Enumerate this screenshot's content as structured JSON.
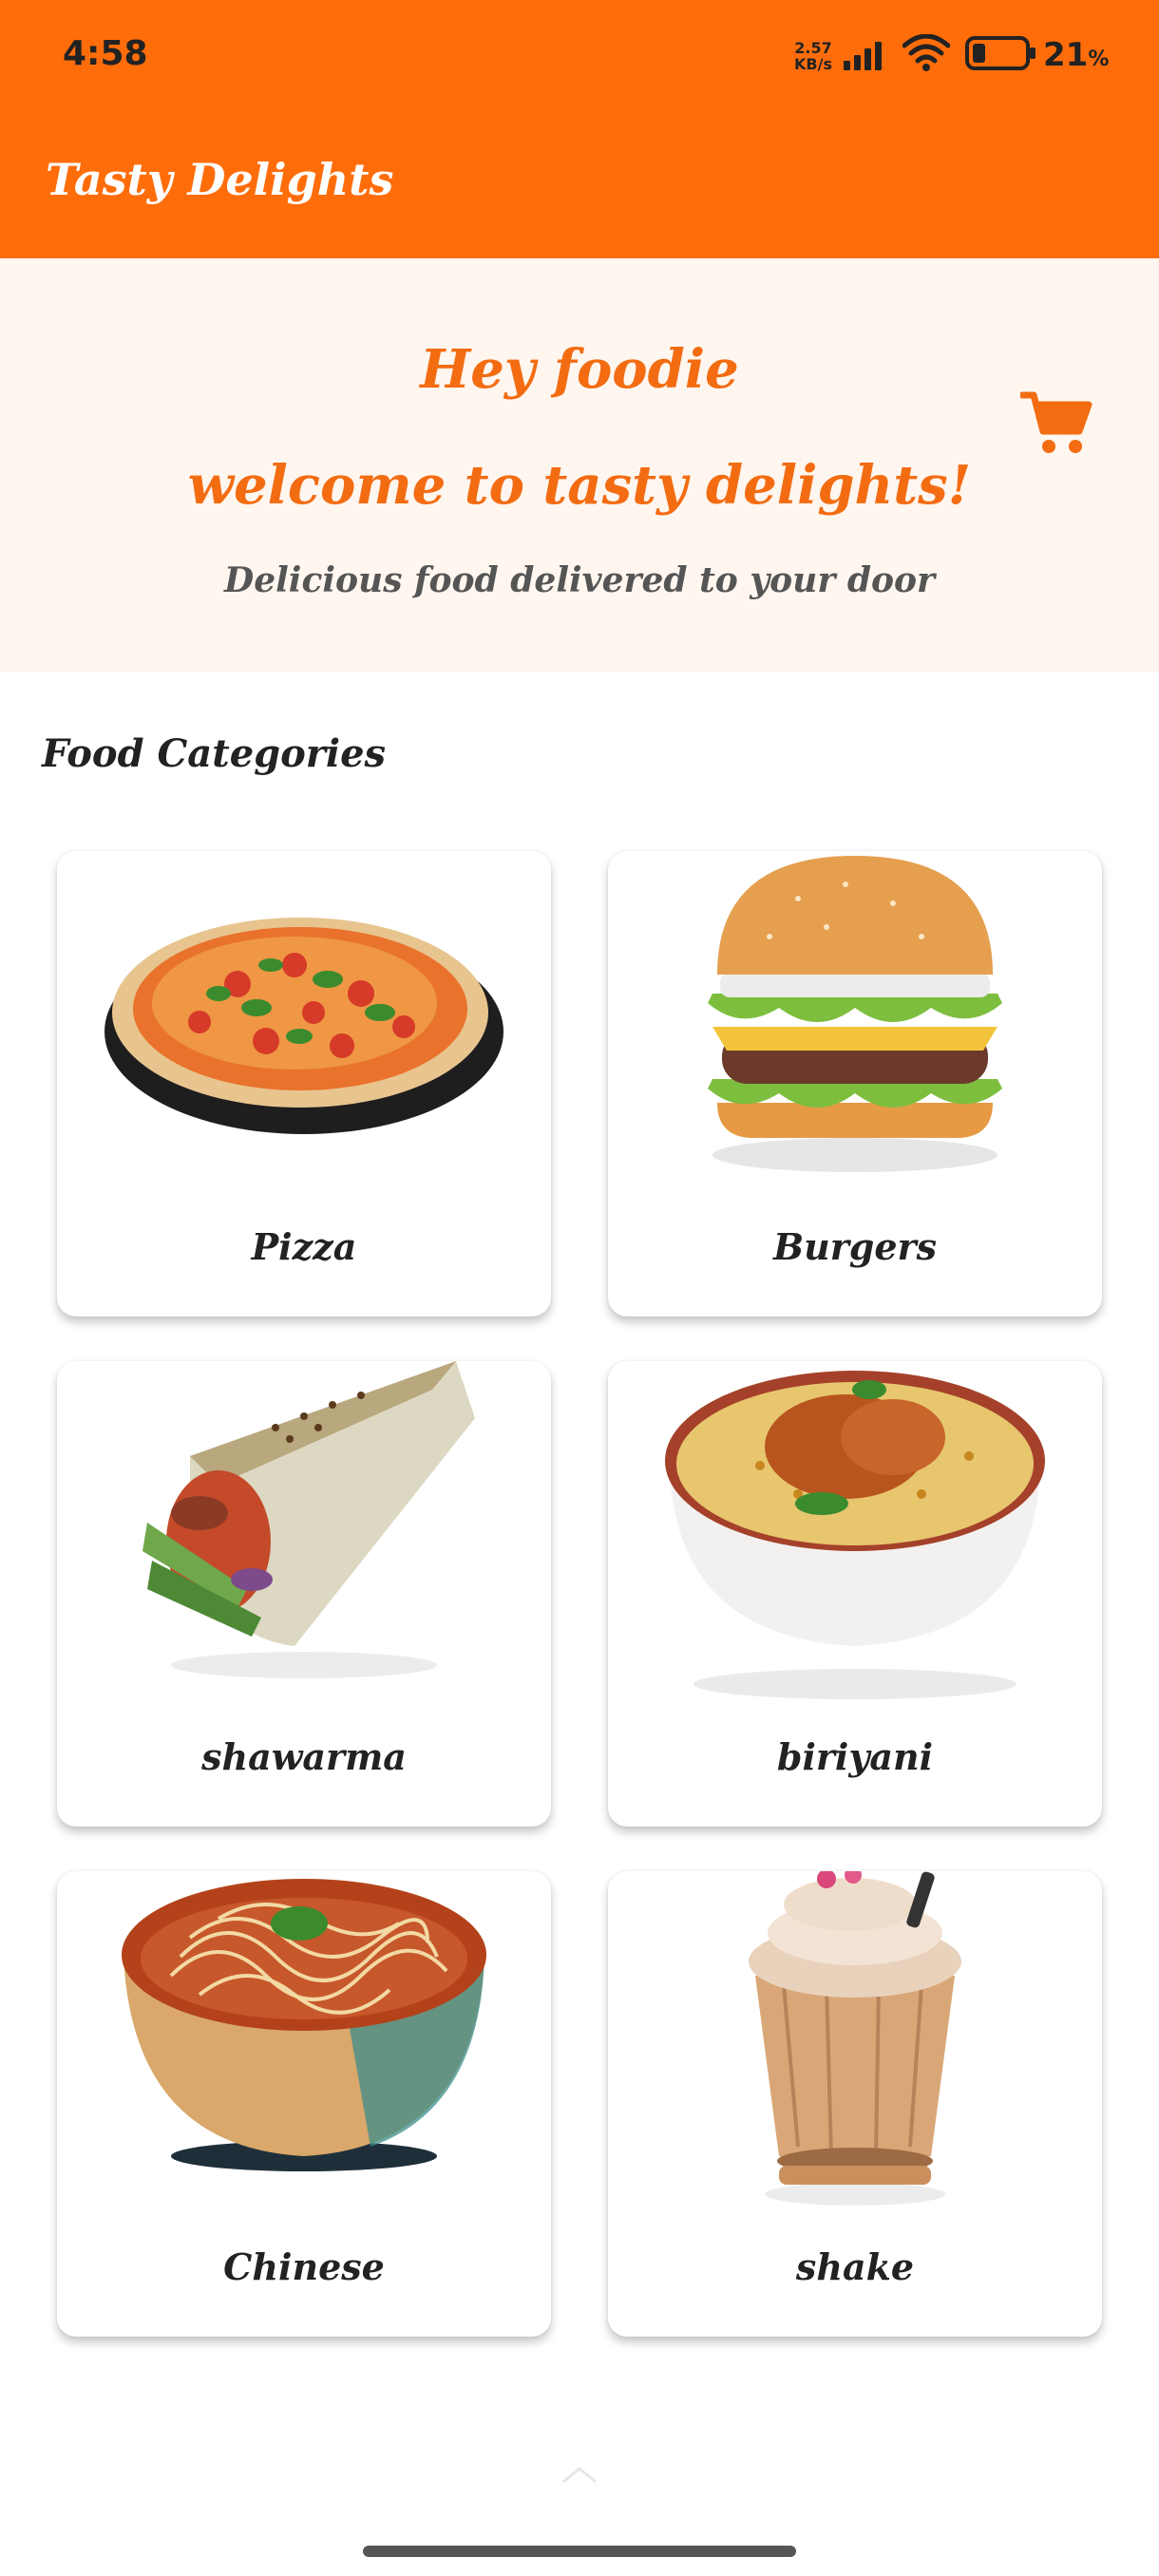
{
  "status_bar": {
    "time": "4:58",
    "net_speed_value": "2.57",
    "net_speed_unit": "KB/s",
    "battery_percent": "21",
    "battery_symbol": "%"
  },
  "app_bar": {
    "title": "Tasty Delights"
  },
  "hero": {
    "greeting_line1": "Hey foodie",
    "greeting_line2": "welcome to tasty delights!",
    "tagline": "Delicious food delivered to your door",
    "cart_icon": "shopping-cart-icon"
  },
  "section": {
    "title": "Food Categories"
  },
  "categories": [
    {
      "label": "Pizza"
    },
    {
      "label": "Burgers"
    },
    {
      "label": "shawarma"
    },
    {
      "label": "biriyani"
    },
    {
      "label": "Chinese"
    },
    {
      "label": "shake"
    }
  ],
  "colors": {
    "brand_orange": "#FF6D0B",
    "heading_orange": "#F36C12",
    "hero_bg": "#FEF6EF"
  }
}
